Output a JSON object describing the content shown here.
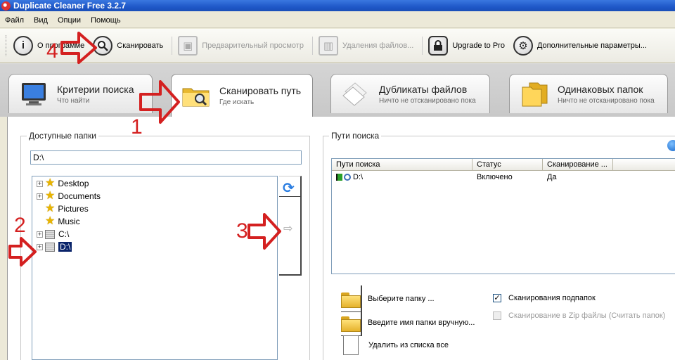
{
  "window": {
    "title": "Duplicate Cleaner Free 3.2.7"
  },
  "menu": [
    "Файл",
    "Вид",
    "Опции",
    "Помощь"
  ],
  "toolbar": {
    "about": "О программе",
    "scan": "Сканировать",
    "preview": "Предварительный просмотр",
    "delete": "Удаления файлов...",
    "upgrade": "Upgrade to Pro",
    "advanced": "Дополнительные параметры..."
  },
  "tabs": [
    {
      "title": "Критерии поиска",
      "subtitle": "Что найти"
    },
    {
      "title": "Сканировать путь",
      "subtitle": "Где искать"
    },
    {
      "title": "Дубликаты файлов",
      "subtitle": "Ничто не отсканировано пока"
    },
    {
      "title": "Одинаковых папок",
      "subtitle": "Ничто не отсканировано пока"
    }
  ],
  "available_folders": {
    "title": "Доступные папки",
    "path_value": "D:\\",
    "tree": [
      "Desktop",
      "Documents",
      "Pictures",
      "Music",
      "C:\\",
      "D:\\"
    ]
  },
  "search_paths": {
    "title": "Пути поиска",
    "columns": [
      "Пути поиска",
      "Статус",
      "Сканирование ..."
    ],
    "rows": [
      {
        "path": "D:\\",
        "status": "Включено",
        "scan": "Да"
      }
    ]
  },
  "actions": {
    "choose_folder": "Выберите папку ...",
    "enter_folder": "Введите имя папки вручную...",
    "remove_all": "Удалить из списка все"
  },
  "options": {
    "scan_subfolders": "Сканирования подпапок",
    "scan_zip": "Сканирование в Zip файлы (Считать папок)"
  },
  "annotations": [
    "1",
    "2",
    "3",
    "4"
  ],
  "colors": {
    "annotation": "#d42020",
    "selection": "#0a246a",
    "title_bar": "#1f58c8"
  }
}
